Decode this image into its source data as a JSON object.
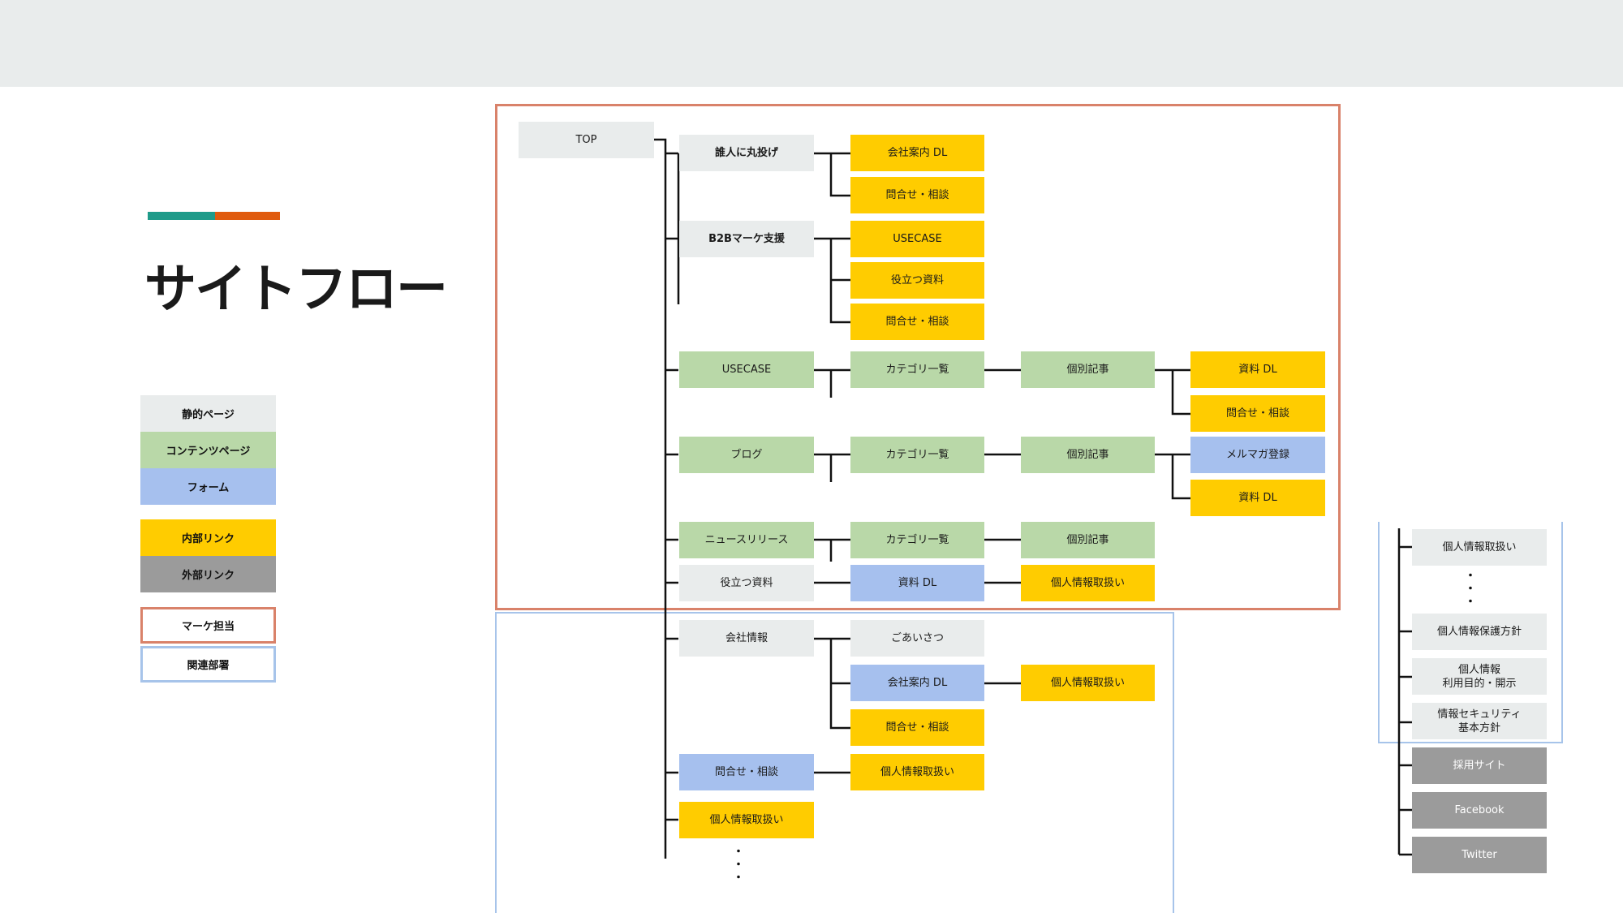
{
  "title": "サイトフロー",
  "legend": {
    "static": "静的ページ",
    "content": "コンテンツページ",
    "form": "フォーム",
    "internal": "内部リンク",
    "external": "外部リンク",
    "marke": "マーケ担当",
    "dept": "関連部署"
  },
  "colors": {
    "static": "#e9ecec",
    "content": "#b9d8a8",
    "form": "#a6c0ee",
    "internal_link": "#ffcc00",
    "external_link": "#9b9b9b",
    "marke_frame": "#d9826a",
    "dept_frame": "#a7c4ea",
    "accent_teal": "#1f9b8a",
    "accent_orange": "#e05b0e"
  },
  "nodes": {
    "top": "TOP",
    "maru": "誰人に丸投げ",
    "maru_dl": "会社案内 DL",
    "maru_contact": "問合せ・相談",
    "b2b": "B2Bマーケ支援",
    "b2b_usecase": "USECASE",
    "b2b_docs": "役立つ資料",
    "b2b_contact": "問合せ・相談",
    "usecase": "USECASE",
    "usecase_cat": "カテゴリ一覧",
    "usecase_article": "個別記事",
    "usecase_dl": "資料 DL",
    "usecase_contact": "問合せ・相談",
    "blog": "ブログ",
    "blog_cat": "カテゴリ一覧",
    "blog_article": "個別記事",
    "blog_mailmag": "メルマガ登録",
    "blog_dl": "資料 DL",
    "news": "ニュースリリース",
    "news_cat": "カテゴリ一覧",
    "news_article": "個別記事",
    "docs": "役立つ資料",
    "docs_dl": "資料 DL",
    "docs_privacy": "個人情報取扱い",
    "company": "会社情報",
    "company_greeting": "ごあいさつ",
    "company_dl": "会社案内 DL",
    "company_dl_privacy": "個人情報取扱い",
    "company_contact": "問合せ・相談",
    "contact": "問合せ・相談",
    "contact_privacy": "個人情報取扱い",
    "privacy": "個人情報取扱い",
    "more_dots": "・\n・\n・",
    "r_privacy": "個人情報取扱い",
    "r_dots": "・\n・\n・",
    "r_policy": "個人情報保護方針",
    "r_purpose": "個人情報\n利用目的・開示",
    "r_security": "情報セキュリティ\n基本方針",
    "r_recruit": "採用サイト",
    "r_facebook": "Facebook",
    "r_twitter": "Twitter"
  }
}
